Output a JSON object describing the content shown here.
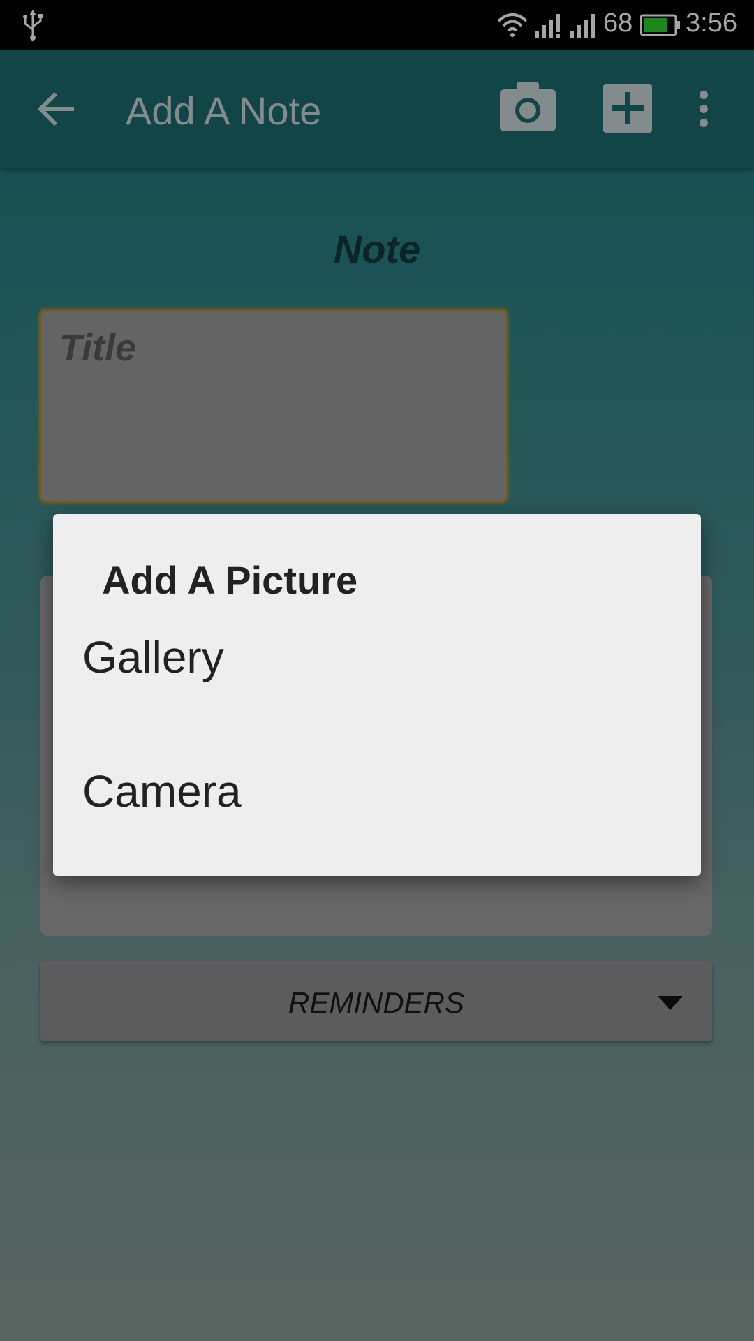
{
  "status_bar": {
    "battery_percent": "68",
    "time": "3:56",
    "battery_color": "#2bd12b"
  },
  "app_bar": {
    "title": "Add A Note"
  },
  "form": {
    "heading": "Note",
    "title_placeholder": "Title",
    "reminders_label": "REMINDERS"
  },
  "dialog": {
    "title": "Add A Picture",
    "options": [
      "Gallery",
      "Camera"
    ]
  },
  "colors": {
    "primary_dark": "#1d6a6e",
    "accent_border": "#b78a1a"
  }
}
